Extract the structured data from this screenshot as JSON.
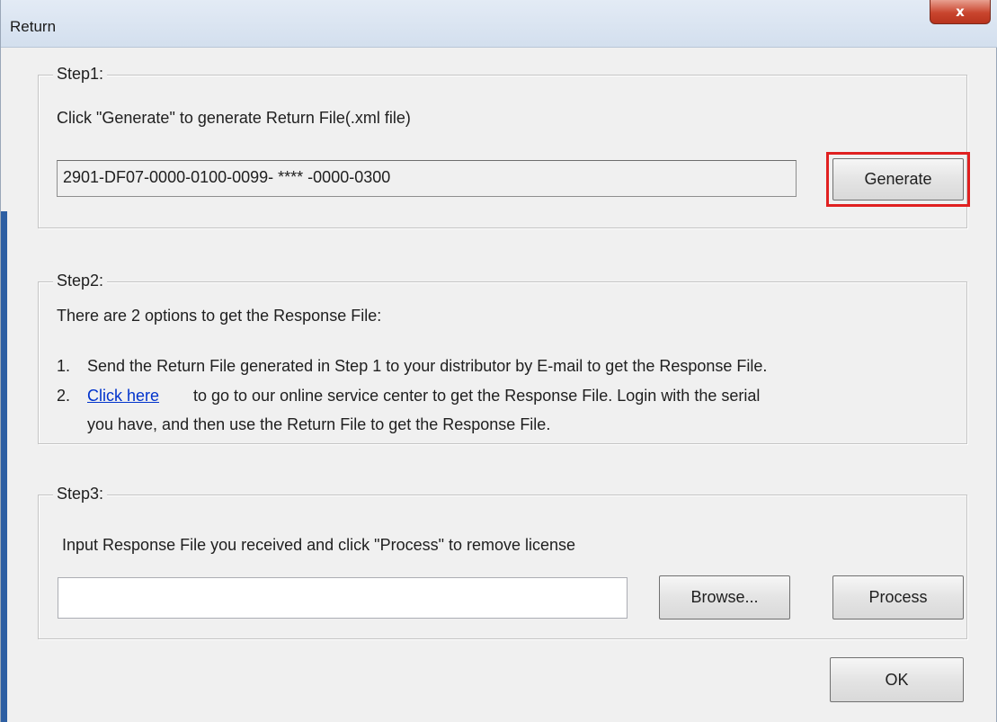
{
  "window": {
    "title": "Return",
    "close_glyph": "x"
  },
  "step1": {
    "legend": "Step1:",
    "instruction": "Click \"Generate\" to generate Return File(.xml file)",
    "serial_value": "2901-DF07-0000-0100-0099- **** -0000-0300",
    "generate_label": "Generate",
    "highlight_color": "#e02020"
  },
  "step2": {
    "legend": "Step2:",
    "intro": "There are 2 options to get the Response File:",
    "option1_num": "1.",
    "option1_text": "Send the Return File generated in Step 1 to your distributor by E-mail to get the Response File.",
    "option2_num": "2.",
    "option2_link": "Click here",
    "option2_text_line1": "to go to our online service center to get the Response File. Login with the serial",
    "option2_text_line2": "you have, and then use the Return File to get the Response File."
  },
  "step3": {
    "legend": "Step3:",
    "instruction": "Input Response File you received and click \"Process\" to remove license",
    "file_value": "",
    "browse_label": "Browse...",
    "process_label": "Process"
  },
  "footer": {
    "ok_label": "OK"
  }
}
